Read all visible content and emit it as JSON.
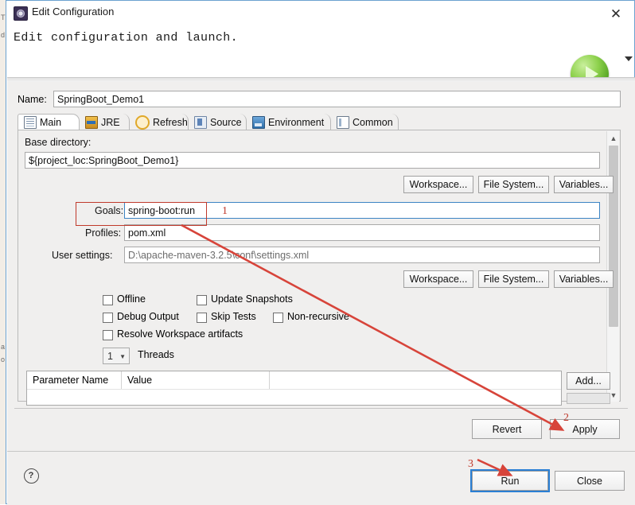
{
  "window": {
    "title": "Edit Configuration",
    "title_icon": "configuration-gear-icon",
    "close_icon": "✕",
    "header_message": "Edit configuration and launch.",
    "run_icon": "run-play-icon"
  },
  "name_field": {
    "label": "Name:",
    "value": "SpringBoot_Demo1"
  },
  "tabs": [
    {
      "label": "Main",
      "icon": "main-tab-icon",
      "selected": true
    },
    {
      "label": "JRE",
      "icon": "jre-tab-icon",
      "selected": false
    },
    {
      "label": "Refresh",
      "icon": "refresh-tab-icon",
      "selected": false
    },
    {
      "label": "Source",
      "icon": "source-tab-icon",
      "selected": false
    },
    {
      "label": "Environment",
      "icon": "environment-tab-icon",
      "selected": false
    },
    {
      "label": "Common",
      "icon": "common-tab-icon",
      "selected": false
    }
  ],
  "main_tab": {
    "base_directory": {
      "label": "Base directory:",
      "value": "${project_loc:SpringBoot_Demo1}"
    },
    "browse_row_1": {
      "workspace": "Workspace...",
      "file_system": "File System...",
      "variables": "Variables..."
    },
    "goals": {
      "label": "Goals:",
      "value": "spring-boot:run"
    },
    "profiles": {
      "label": "Profiles:",
      "value": "pom.xml"
    },
    "user_settings": {
      "label": "User settings:",
      "value": "D:\\apache-maven-3.2.5\\conf\\settings.xml"
    },
    "browse_row_2": {
      "workspace": "Workspace...",
      "file_system": "File System...",
      "variables": "Variables..."
    },
    "checkboxes": [
      {
        "label": "Offline",
        "checked": false
      },
      {
        "label": "Update Snapshots",
        "checked": false
      },
      {
        "label": "Debug Output",
        "checked": false
      },
      {
        "label": "Skip Tests",
        "checked": false
      },
      {
        "label": "Non-recursive",
        "checked": false
      },
      {
        "label": "Resolve Workspace artifacts",
        "checked": false
      }
    ],
    "threads": {
      "value": "1",
      "label": "Threads"
    },
    "parameters_table": {
      "columns": [
        "Parameter Name",
        "Value"
      ],
      "rows": []
    },
    "table_buttons": {
      "add": "Add..."
    }
  },
  "action_buttons": {
    "revert": "Revert",
    "apply": "Apply",
    "run": "Run",
    "close": "Close",
    "help_icon": "help-question-icon"
  },
  "annotations": {
    "numbers": [
      "1",
      "2",
      "3"
    ],
    "color": "#c0392b"
  },
  "background_glyphs": [
    "T",
    "d",
    "a",
    "o"
  ]
}
